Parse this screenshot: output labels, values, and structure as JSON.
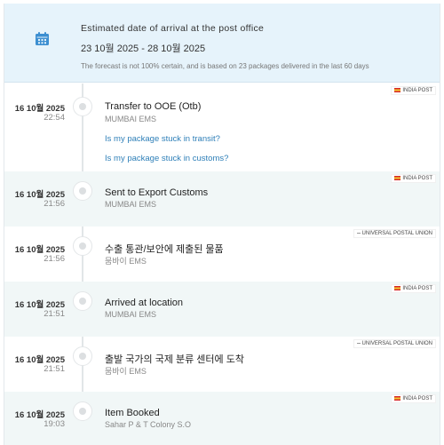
{
  "eta": {
    "icon": "calendar-icon",
    "label": "Estimated date of arrival at the post office",
    "dates": "23 10월 2025 - 28 10월 2025",
    "note": "The forecast is not 100% certain, and is based on 23 packages delivered in the last 60 days"
  },
  "events": [
    {
      "date": "16 10월 2025",
      "time": "22:54",
      "title": "Transfer to OOE (Otb)",
      "location": "MUMBAI EMS",
      "source": "INDIA POST",
      "links": [
        "Is my package stuck in transit?",
        "Is my package stuck in customs?"
      ]
    },
    {
      "date": "16 10월 2025",
      "time": "21:56",
      "title": "Sent to Export Customs",
      "location": "MUMBAI EMS",
      "source": "INDIA POST"
    },
    {
      "date": "16 10월 2025",
      "time": "21:56",
      "title": "수출 통관/보안에 제출된 물품",
      "location": "뭄바이 EMS",
      "source": "UNIVERSAL POSTAL UNION"
    },
    {
      "date": "16 10월 2025",
      "time": "21:51",
      "title": "Arrived at location",
      "location": "MUMBAI EMS",
      "source": "INDIA POST"
    },
    {
      "date": "16 10월 2025",
      "time": "21:51",
      "title": "출발 국가의 국제 분류 센터에 도착",
      "location": "뭄바이 EMS",
      "source": "UNIVERSAL POSTAL UNION"
    },
    {
      "date": "16 10월 2025",
      "time": "19:03",
      "title": "Item Booked",
      "location": "Sahar P & T Colony S.O",
      "source": "INDIA POST"
    }
  ],
  "colors": {
    "eta_bg": "#e6f3fb",
    "accent": "#3d8fd1",
    "link": "#2e7fb8",
    "alt_row": "#f1f7f7"
  }
}
